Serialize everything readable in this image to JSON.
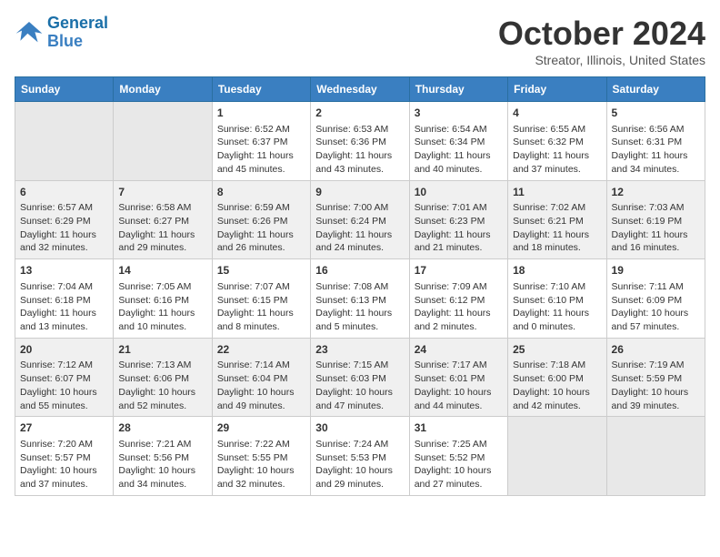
{
  "header": {
    "logo_line1": "General",
    "logo_line2": "Blue",
    "month": "October 2024",
    "location": "Streator, Illinois, United States"
  },
  "weekdays": [
    "Sunday",
    "Monday",
    "Tuesday",
    "Wednesday",
    "Thursday",
    "Friday",
    "Saturday"
  ],
  "rows": [
    [
      {
        "day": "",
        "lines": []
      },
      {
        "day": "",
        "lines": []
      },
      {
        "day": "1",
        "lines": [
          "Sunrise: 6:52 AM",
          "Sunset: 6:37 PM",
          "Daylight: 11 hours",
          "and 45 minutes."
        ]
      },
      {
        "day": "2",
        "lines": [
          "Sunrise: 6:53 AM",
          "Sunset: 6:36 PM",
          "Daylight: 11 hours",
          "and 43 minutes."
        ]
      },
      {
        "day": "3",
        "lines": [
          "Sunrise: 6:54 AM",
          "Sunset: 6:34 PM",
          "Daylight: 11 hours",
          "and 40 minutes."
        ]
      },
      {
        "day": "4",
        "lines": [
          "Sunrise: 6:55 AM",
          "Sunset: 6:32 PM",
          "Daylight: 11 hours",
          "and 37 minutes."
        ]
      },
      {
        "day": "5",
        "lines": [
          "Sunrise: 6:56 AM",
          "Sunset: 6:31 PM",
          "Daylight: 11 hours",
          "and 34 minutes."
        ]
      }
    ],
    [
      {
        "day": "6",
        "lines": [
          "Sunrise: 6:57 AM",
          "Sunset: 6:29 PM",
          "Daylight: 11 hours",
          "and 32 minutes."
        ]
      },
      {
        "day": "7",
        "lines": [
          "Sunrise: 6:58 AM",
          "Sunset: 6:27 PM",
          "Daylight: 11 hours",
          "and 29 minutes."
        ]
      },
      {
        "day": "8",
        "lines": [
          "Sunrise: 6:59 AM",
          "Sunset: 6:26 PM",
          "Daylight: 11 hours",
          "and 26 minutes."
        ]
      },
      {
        "day": "9",
        "lines": [
          "Sunrise: 7:00 AM",
          "Sunset: 6:24 PM",
          "Daylight: 11 hours",
          "and 24 minutes."
        ]
      },
      {
        "day": "10",
        "lines": [
          "Sunrise: 7:01 AM",
          "Sunset: 6:23 PM",
          "Daylight: 11 hours",
          "and 21 minutes."
        ]
      },
      {
        "day": "11",
        "lines": [
          "Sunrise: 7:02 AM",
          "Sunset: 6:21 PM",
          "Daylight: 11 hours",
          "and 18 minutes."
        ]
      },
      {
        "day": "12",
        "lines": [
          "Sunrise: 7:03 AM",
          "Sunset: 6:19 PM",
          "Daylight: 11 hours",
          "and 16 minutes."
        ]
      }
    ],
    [
      {
        "day": "13",
        "lines": [
          "Sunrise: 7:04 AM",
          "Sunset: 6:18 PM",
          "Daylight: 11 hours",
          "and 13 minutes."
        ]
      },
      {
        "day": "14",
        "lines": [
          "Sunrise: 7:05 AM",
          "Sunset: 6:16 PM",
          "Daylight: 11 hours",
          "and 10 minutes."
        ]
      },
      {
        "day": "15",
        "lines": [
          "Sunrise: 7:07 AM",
          "Sunset: 6:15 PM",
          "Daylight: 11 hours",
          "and 8 minutes."
        ]
      },
      {
        "day": "16",
        "lines": [
          "Sunrise: 7:08 AM",
          "Sunset: 6:13 PM",
          "Daylight: 11 hours",
          "and 5 minutes."
        ]
      },
      {
        "day": "17",
        "lines": [
          "Sunrise: 7:09 AM",
          "Sunset: 6:12 PM",
          "Daylight: 11 hours",
          "and 2 minutes."
        ]
      },
      {
        "day": "18",
        "lines": [
          "Sunrise: 7:10 AM",
          "Sunset: 6:10 PM",
          "Daylight: 11 hours",
          "and 0 minutes."
        ]
      },
      {
        "day": "19",
        "lines": [
          "Sunrise: 7:11 AM",
          "Sunset: 6:09 PM",
          "Daylight: 10 hours",
          "and 57 minutes."
        ]
      }
    ],
    [
      {
        "day": "20",
        "lines": [
          "Sunrise: 7:12 AM",
          "Sunset: 6:07 PM",
          "Daylight: 10 hours",
          "and 55 minutes."
        ]
      },
      {
        "day": "21",
        "lines": [
          "Sunrise: 7:13 AM",
          "Sunset: 6:06 PM",
          "Daylight: 10 hours",
          "and 52 minutes."
        ]
      },
      {
        "day": "22",
        "lines": [
          "Sunrise: 7:14 AM",
          "Sunset: 6:04 PM",
          "Daylight: 10 hours",
          "and 49 minutes."
        ]
      },
      {
        "day": "23",
        "lines": [
          "Sunrise: 7:15 AM",
          "Sunset: 6:03 PM",
          "Daylight: 10 hours",
          "and 47 minutes."
        ]
      },
      {
        "day": "24",
        "lines": [
          "Sunrise: 7:17 AM",
          "Sunset: 6:01 PM",
          "Daylight: 10 hours",
          "and 44 minutes."
        ]
      },
      {
        "day": "25",
        "lines": [
          "Sunrise: 7:18 AM",
          "Sunset: 6:00 PM",
          "Daylight: 10 hours",
          "and 42 minutes."
        ]
      },
      {
        "day": "26",
        "lines": [
          "Sunrise: 7:19 AM",
          "Sunset: 5:59 PM",
          "Daylight: 10 hours",
          "and 39 minutes."
        ]
      }
    ],
    [
      {
        "day": "27",
        "lines": [
          "Sunrise: 7:20 AM",
          "Sunset: 5:57 PM",
          "Daylight: 10 hours",
          "and 37 minutes."
        ]
      },
      {
        "day": "28",
        "lines": [
          "Sunrise: 7:21 AM",
          "Sunset: 5:56 PM",
          "Daylight: 10 hours",
          "and 34 minutes."
        ]
      },
      {
        "day": "29",
        "lines": [
          "Sunrise: 7:22 AM",
          "Sunset: 5:55 PM",
          "Daylight: 10 hours",
          "and 32 minutes."
        ]
      },
      {
        "day": "30",
        "lines": [
          "Sunrise: 7:24 AM",
          "Sunset: 5:53 PM",
          "Daylight: 10 hours",
          "and 29 minutes."
        ]
      },
      {
        "day": "31",
        "lines": [
          "Sunrise: 7:25 AM",
          "Sunset: 5:52 PM",
          "Daylight: 10 hours",
          "and 27 minutes."
        ]
      },
      {
        "day": "",
        "lines": []
      },
      {
        "day": "",
        "lines": []
      }
    ]
  ]
}
